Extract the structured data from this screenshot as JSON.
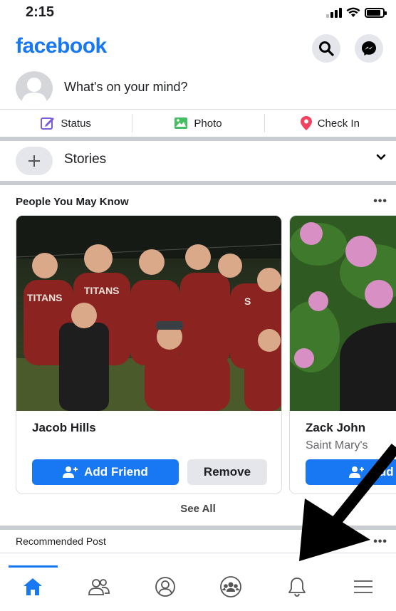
{
  "status_bar": {
    "time": "2:15"
  },
  "header": {
    "logo": "facebook",
    "search_icon": "search-icon",
    "messenger_icon": "messenger-icon"
  },
  "composer": {
    "prompt": "What's on your mind?"
  },
  "actions": [
    {
      "label": "Status",
      "icon": "status-edit-icon",
      "color": "#7b5cd6"
    },
    {
      "label": "Photo",
      "icon": "photo-icon",
      "color": "#45bd62"
    },
    {
      "label": "Check In",
      "icon": "location-pin-icon",
      "color": "#f3425f"
    }
  ],
  "stories": {
    "label": "Stories"
  },
  "pymk": {
    "title": "People You May Know",
    "more": "•••",
    "cards": [
      {
        "name": "Jacob Hills",
        "mutual": "",
        "add_label": "Add Friend",
        "remove_label": "Remove"
      },
      {
        "name": "Zack John",
        "mutual": "Saint Mary's",
        "add_label": "Add Fr"
      }
    ],
    "see_all": "See All"
  },
  "recommended": {
    "title": "Recommended Post",
    "more": "•••"
  },
  "tabbar": [
    "home-icon",
    "friends-icon",
    "profile-icon",
    "groups-icon",
    "notifications-icon",
    "menu-icon"
  ],
  "colors": {
    "brand": "#1877f2",
    "separator": "#c9ccd1"
  }
}
